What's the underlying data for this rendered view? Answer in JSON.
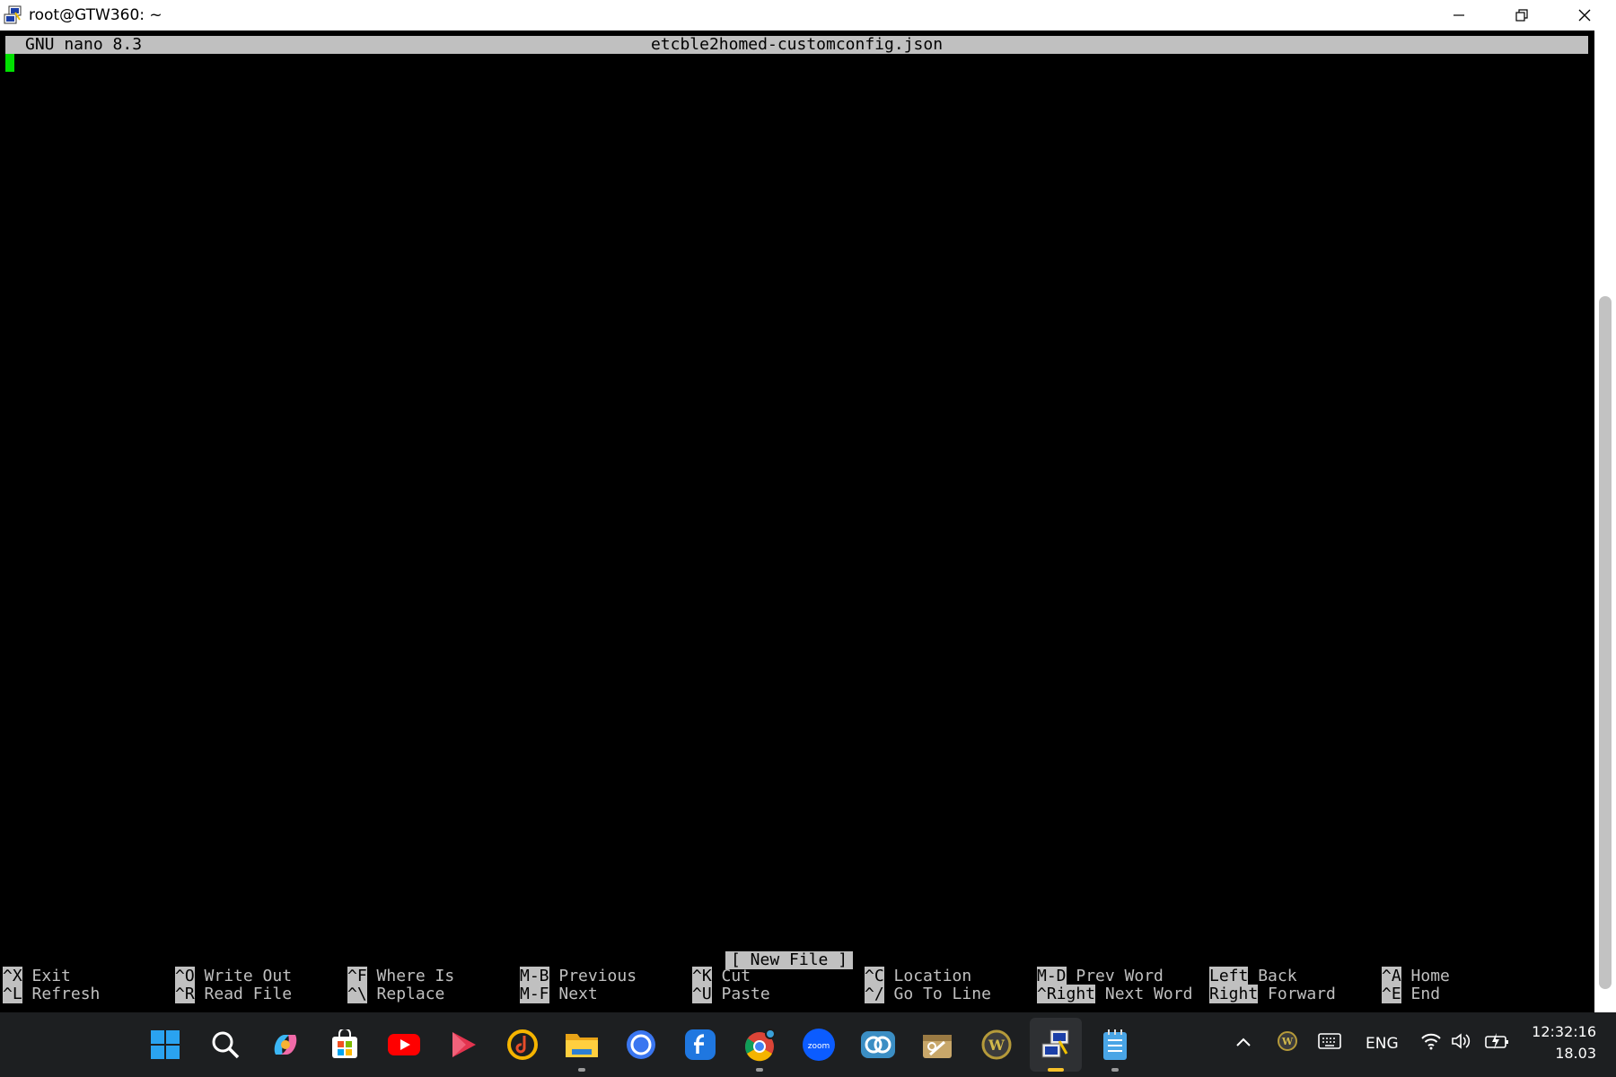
{
  "window": {
    "title": "root@GTW360: ~"
  },
  "nano": {
    "version": "GNU nano 8.3",
    "filename": "etcble2homed-customconfig.json",
    "status": "[ New File ]",
    "shortcuts_row1": [
      {
        "key": "^X",
        "label": "Exit"
      },
      {
        "key": "^O",
        "label": "Write Out"
      },
      {
        "key": "^F",
        "label": "Where Is"
      },
      {
        "key": "M-B",
        "label": "Previous"
      },
      {
        "key": "^K",
        "label": "Cut"
      },
      {
        "key": "^C",
        "label": "Location"
      },
      {
        "key": "M-D",
        "label": "Prev Word"
      },
      {
        "key": "Left",
        "label": "Back"
      },
      {
        "key": "^A",
        "label": "Home"
      }
    ],
    "shortcuts_row2": [
      {
        "key": "^L",
        "label": "Refresh"
      },
      {
        "key": "^R",
        "label": "Read File"
      },
      {
        "key": "^\\",
        "label": "Replace"
      },
      {
        "key": "M-F",
        "label": "Next"
      },
      {
        "key": "^U",
        "label": "Paste"
      },
      {
        "key": "^/",
        "label": "Go To Line"
      },
      {
        "key": "^Right",
        "label": "Next Word"
      },
      {
        "key": "Right",
        "label": "Forward"
      },
      {
        "key": "^E",
        "label": "End"
      }
    ]
  },
  "taskbar": {
    "language": "ENG",
    "time": "12:32:16",
    "date": "18.03",
    "apps": [
      "start",
      "search",
      "copilot",
      "store",
      "youtube",
      "player",
      "music",
      "file-explorer",
      "signal",
      "fedora",
      "chrome",
      "zoom",
      "teams",
      "tools",
      "wordpress",
      "putty",
      "notepad"
    ]
  },
  "colors": {
    "terminal_bg": "#000000",
    "bar_bg": "#c0c0c0",
    "cursor": "#00e000",
    "taskbar_bg": "#1d1f21"
  }
}
